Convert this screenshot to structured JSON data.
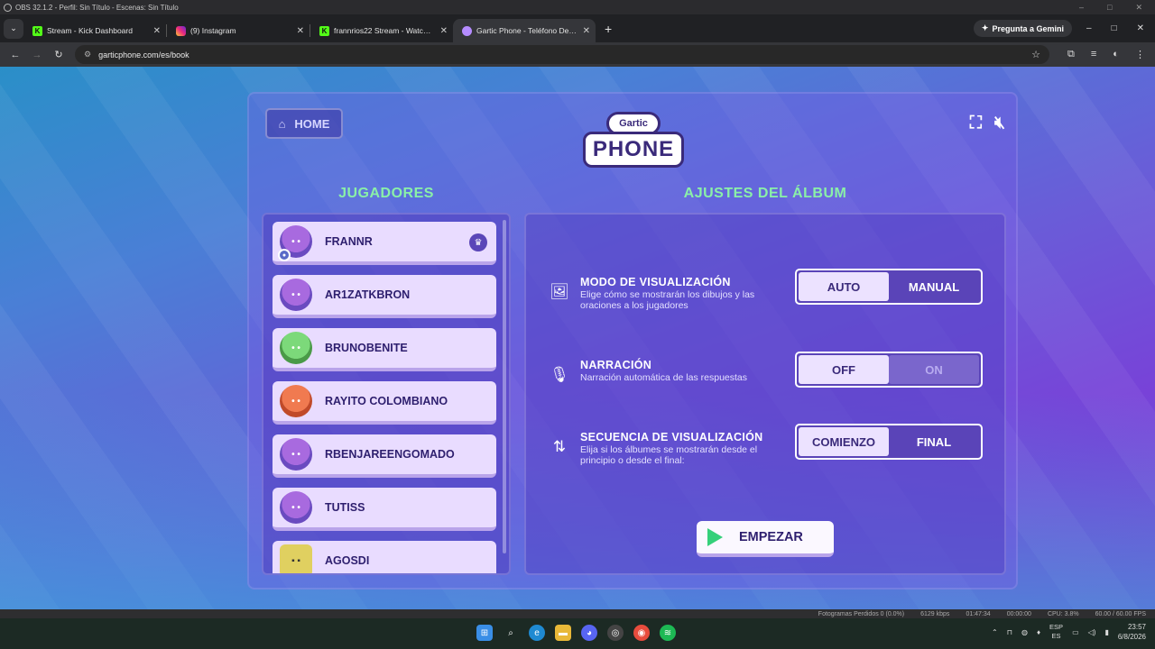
{
  "obs": {
    "title": "OBS 32.1.2 - Perfil: Sin Título - Escenas: Sin Título",
    "status": [
      "Fotogramas Perdidos 0 (0.0%)",
      "6129 kbps",
      "01:47:34",
      "00:00:00",
      "CPU: 3.8%",
      "60.00 / 60.00 FPS"
    ]
  },
  "browser": {
    "tabs": [
      {
        "label": "Stream - Kick Dashboard",
        "favicon": "kick-icon",
        "active": false
      },
      {
        "label": "(9) Instagram",
        "favicon": "instagram-icon",
        "active": false
      },
      {
        "label": "frannrios22 Stream - Watch Live",
        "favicon": "kick-icon",
        "active": false
      },
      {
        "label": "Gartic Phone - Teléfono Descompuesto",
        "favicon": "gartic-icon",
        "active": true
      }
    ],
    "gemini_label": "Pregunta a Gemini",
    "url": "garticphone.com/es/book"
  },
  "game": {
    "home_label": "HOME",
    "logo_top": "Gartic",
    "logo_bottom": "PHONE",
    "players_title": "JUGADORES",
    "settings_title": "AJUSTES DEL ÁLBUM",
    "players": [
      {
        "name": "FRANNR",
        "avatar": "purple",
        "host": true
      },
      {
        "name": "AR1ZATKBRON",
        "avatar": "purple",
        "host": false
      },
      {
        "name": "BRUNOBENITE",
        "avatar": "frog",
        "host": false
      },
      {
        "name": "RAYITO COLOMBIANO",
        "avatar": "fish",
        "host": false
      },
      {
        "name": "RBENJAREENGOMADO",
        "avatar": "purple",
        "host": false
      },
      {
        "name": "TUTISS",
        "avatar": "purple",
        "host": false
      },
      {
        "name": "AGOSDI",
        "avatar": "robot",
        "host": false
      }
    ],
    "settings": [
      {
        "title": "MODO DE VISUALIZACIÓN",
        "description": "Elige cómo se mostrarán los dibujos y las oraciones a los jugadores",
        "icon": "image-icon",
        "options": [
          "AUTO",
          "MANUAL"
        ],
        "selected": "AUTO"
      },
      {
        "title": "NARRACIÓN",
        "description": "Narración automática de las respuestas",
        "icon": "microphone-icon",
        "options": [
          "OFF",
          "ON"
        ],
        "selected": "OFF"
      },
      {
        "title": "SECUENCIA DE VISUALIZACIÓN",
        "description": "Elija si los álbumes se mostrarán desde el principio o desde el final:",
        "icon": "sort-arrows-icon",
        "options": [
          "COMIENZO",
          "FINAL"
        ],
        "selected": "COMIENZO"
      }
    ],
    "start_label": "EMPEZAR"
  },
  "taskbar": {
    "lang_top": "ESP",
    "lang_bottom": "ES",
    "time": "23:57",
    "date": "6/8/2026"
  }
}
